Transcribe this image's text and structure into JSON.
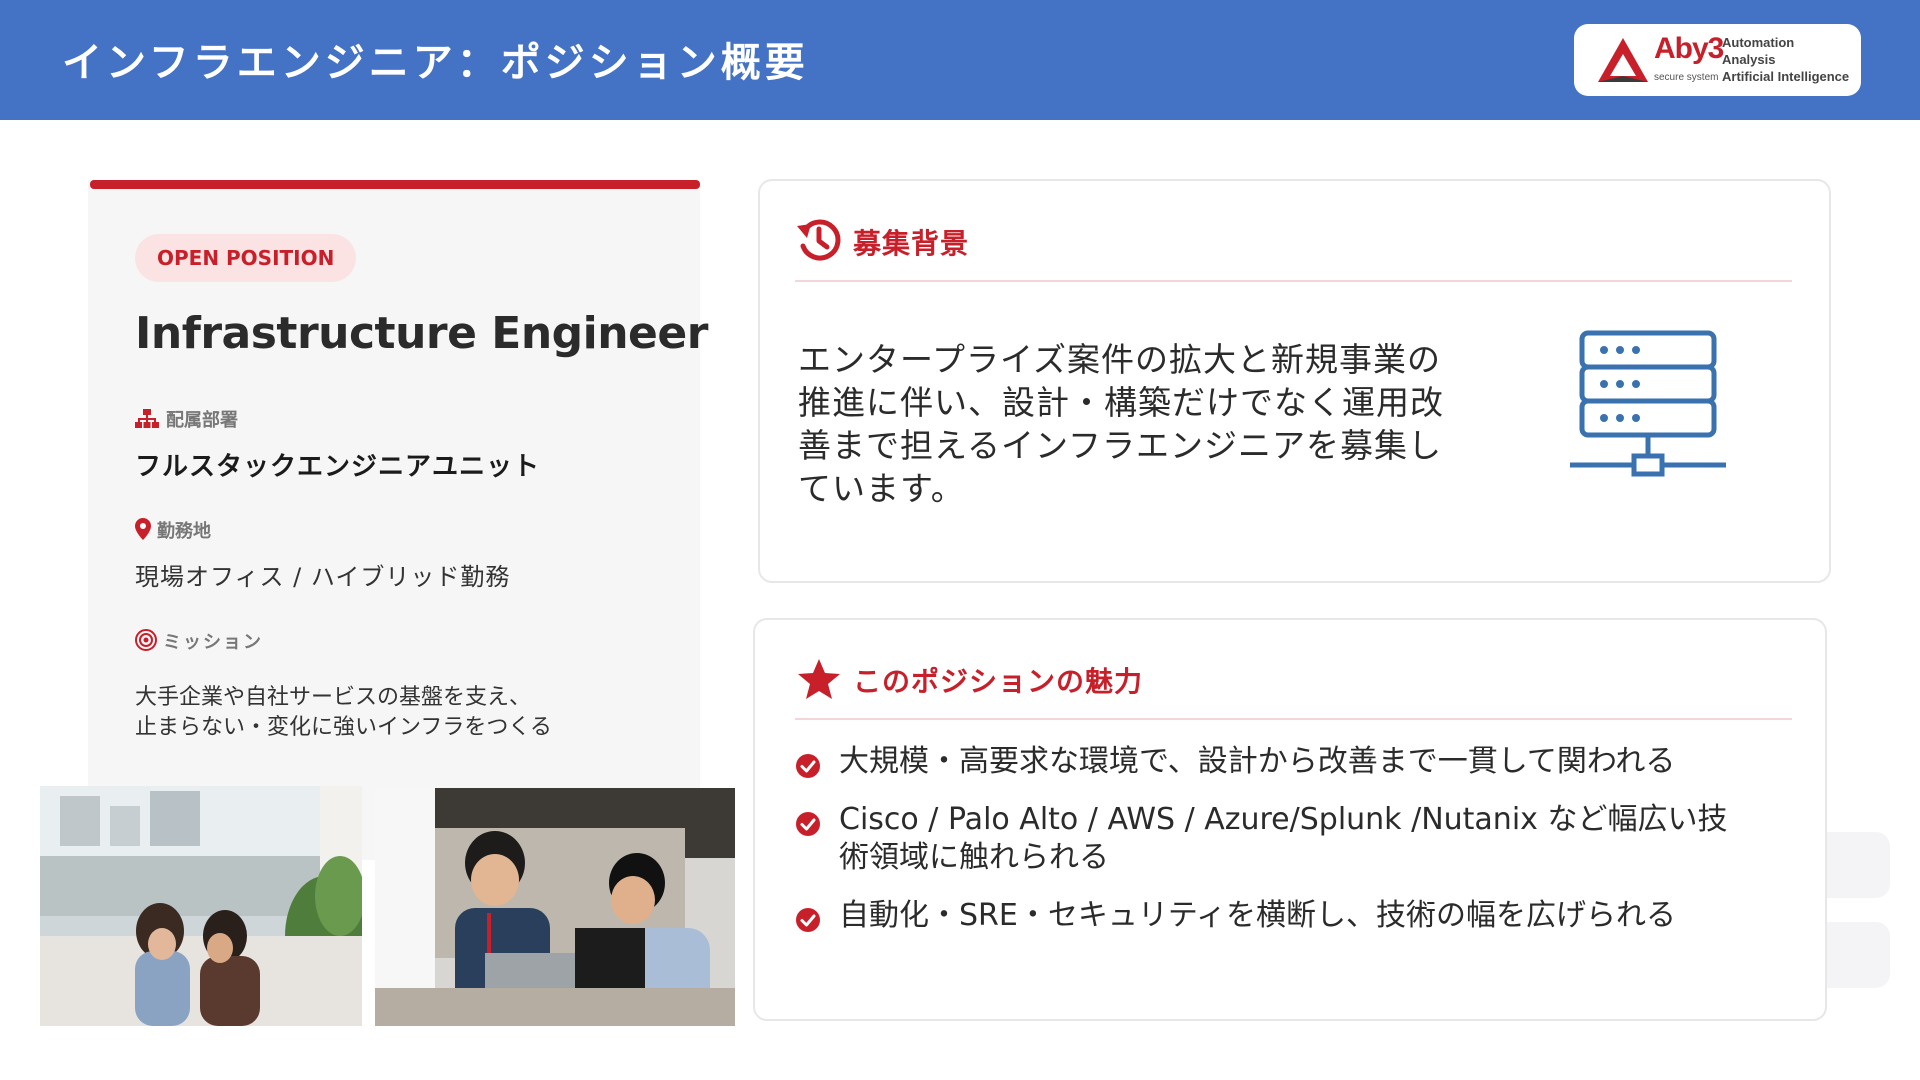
{
  "header": {
    "title": "インフラエンジニア：ポジション概要",
    "bg_color": "#4472c4"
  },
  "logo": {
    "brand": "Aby3",
    "subtitle": "secure system",
    "lines": [
      "Automation",
      "Analysis",
      "Artificial Intelligence"
    ]
  },
  "position": {
    "badge": "OPEN POSITION",
    "title": "Infrastructure Engineer",
    "department_label": "配属部署",
    "department": "フルスタックエンジニアユニット",
    "location_label": "勤務地",
    "location": "現場オフィス / ハイブリッド勤務",
    "mission_label": "ミッション",
    "mission_lines": [
      "大手企業や自社サービスの基盤を支え、",
      "止まらない・変化に強いインフラをつくる"
    ]
  },
  "background_card": {
    "title": "募集背景",
    "body_lines": [
      "エンタープライズ案件の拡大と新規事業の",
      "推進に伴い、設計・構築だけでなく運用改",
      "善まで担えるインフラエンジニアを募集し",
      "ています。"
    ],
    "icon": "server-network-icon"
  },
  "appeal_card": {
    "title": "このポジションの魅力",
    "items": [
      {
        "lines": [
          "大規模・高要求な環境で、設計から改善まで一貫して関われる"
        ]
      },
      {
        "lines": [
          "Cisco / Palo Alto / AWS / Azure/Splunk /Nutanix など幅広い技",
          "術領域に触れられる"
        ]
      },
      {
        "lines": [
          "自動化・SRE・セキュリティを横断し、技術の幅を広げられる"
        ]
      }
    ]
  },
  "colors": {
    "accent": "#c8202a",
    "badge_bg": "#fbe3e4",
    "card_border": "#e7e7e9",
    "icon_blue": "#3a72b0"
  }
}
